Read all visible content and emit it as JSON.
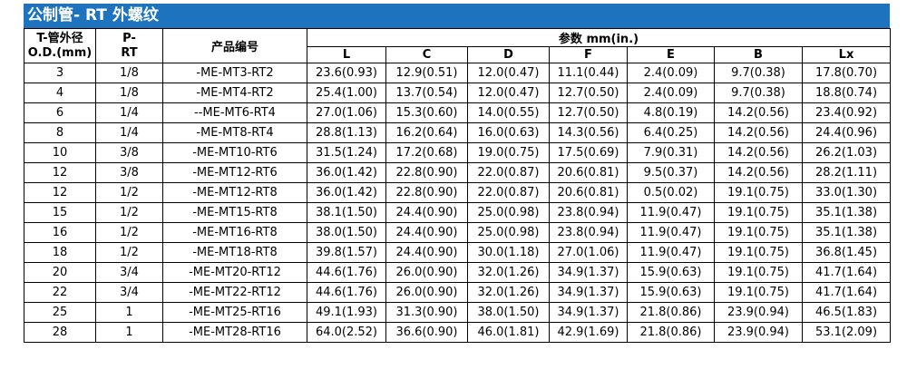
{
  "title": "公制管- RT 外螺纹",
  "headers": {
    "od_line1": "T-管外径",
    "od_line2": "O.D.(mm)",
    "pt_line1": "P-",
    "pt_line2": "RT",
    "product_code": "产品编号",
    "params_group": "参数 mm(in.)",
    "params": [
      "L",
      "C",
      "D",
      "F",
      "E",
      "B",
      "Lx"
    ]
  },
  "rows": [
    {
      "od": "3",
      "pt": "1/8",
      "code": "-ME-MT3-RT2",
      "vals": [
        "23.6(0.93)",
        "12.9(0.51)",
        "12.0(0.47)",
        "11.1(0.44)",
        "2.4(0.09)",
        "9.7(0.38)",
        "17.8(0.70)"
      ]
    },
    {
      "od": "4",
      "pt": "1/8",
      "code": "-ME-MT4-RT2",
      "vals": [
        "25.4(1.00)",
        "13.7(0.54)",
        "12.0(0.47)",
        "12.7(0.50)",
        "2.4(0.09)",
        "9.7(0.38)",
        "18.8(0.74)"
      ]
    },
    {
      "od": "6",
      "pt": "1/4",
      "code": "--ME-MT6-RT4",
      "vals": [
        "27.0(1.06)",
        "15.3(0.60)",
        "14.0(0.55)",
        "12.7(0.50)",
        "4.8(0.19)",
        "14.2(0.56)",
        "23.4(0.92)"
      ]
    },
    {
      "od": "8",
      "pt": "1/4",
      "code": "-ME-MT8-RT4",
      "vals": [
        "28.8(1.13)",
        "16.2(0.64)",
        "16.0(0.63)",
        "14.3(0.56)",
        "6.4(0.25)",
        "14.2(0.56)",
        "24.4(0.96)"
      ]
    },
    {
      "od": "10",
      "pt": "3/8",
      "code": "-ME-MT10-RT6",
      "vals": [
        "31.5(1.24)",
        "17.2(0.68)",
        "19.0(0.75)",
        "17.5(0.69)",
        "7.9(0.31)",
        "14.2(0.56)",
        "26.2(1.03)"
      ]
    },
    {
      "od": "12",
      "pt": "3/8",
      "code": "-ME-MT12-RT6",
      "vals": [
        "36.0(1.42)",
        "22.8(0.90)",
        "22.0(0.87)",
        "20.6(0.81)",
        "9.5(0.37)",
        "14.2(0.56)",
        "28.2(1.11)"
      ]
    },
    {
      "od": "12",
      "pt": "1/2",
      "code": "-ME-MT12-RT8",
      "vals": [
        "36.0(1.42)",
        "22.8(0.90)",
        "22.0(0.87)",
        "20.6(0.81)",
        "0.5(0.02)",
        "19.1(0.75)",
        "33.0(1.30)"
      ]
    },
    {
      "od": "15",
      "pt": "1/2",
      "code": "-ME-MT15-RT8",
      "vals": [
        "38.1(1.50)",
        "24.4(0.90)",
        "25.0(0.98)",
        "23.8(0.94)",
        "11.9(0.47)",
        "19.1(0.75)",
        "35.1(1.38)"
      ]
    },
    {
      "od": "16",
      "pt": "1/2",
      "code": "-ME-MT16-RT8",
      "vals": [
        "38.0(1.50)",
        "24.4(0.90)",
        "25.0(0.98)",
        "23.8(0.94)",
        "11.9(0.47)",
        "19.1(0.75)",
        "35.1(1.38)"
      ]
    },
    {
      "od": "18",
      "pt": "1/2",
      "code": "-ME-MT18-RT8",
      "vals": [
        "39.8(1.57)",
        "24.4(0.90)",
        "30.0(1.18)",
        "27.0(1.06)",
        "11.9(0.47)",
        "19.1(0.75)",
        "36.8(1.45)"
      ]
    },
    {
      "od": "20",
      "pt": "3/4",
      "code": "-ME-MT20-RT12",
      "vals": [
        "44.6(1.76)",
        "26.0(0.90)",
        "32.0(1.26)",
        "34.9(1.37)",
        "15.9(0.63)",
        "19.1(0.75)",
        "41.7(1.64)"
      ]
    },
    {
      "od": "22",
      "pt": "3/4",
      "code": "-ME-MT22-RT12",
      "vals": [
        "44.6(1.76)",
        "26.0(0.90)",
        "32.0(1.26)",
        "34.9(1.37)",
        "15.9(0.63)",
        "19.1(0.75)",
        "41.7(1.64)"
      ]
    },
    {
      "od": "25",
      "pt": "1",
      "code": "-ME-MT25-RT16",
      "vals": [
        "49.1(1.93)",
        "31.3(0.90)",
        "38.0(1.50)",
        "34.9(1.37)",
        "21.8(0.86)",
        "23.9(0.94)",
        "46.5(1.83)"
      ]
    },
    {
      "od": "28",
      "pt": "1",
      "code": "-ME-MT28-RT16",
      "vals": [
        "64.0(2.52)",
        "36.6(0.90)",
        "46.0(1.81)",
        "42.9(1.69)",
        "21.8(0.86)",
        "23.9(0.94)",
        "53.1(2.09)"
      ]
    }
  ]
}
